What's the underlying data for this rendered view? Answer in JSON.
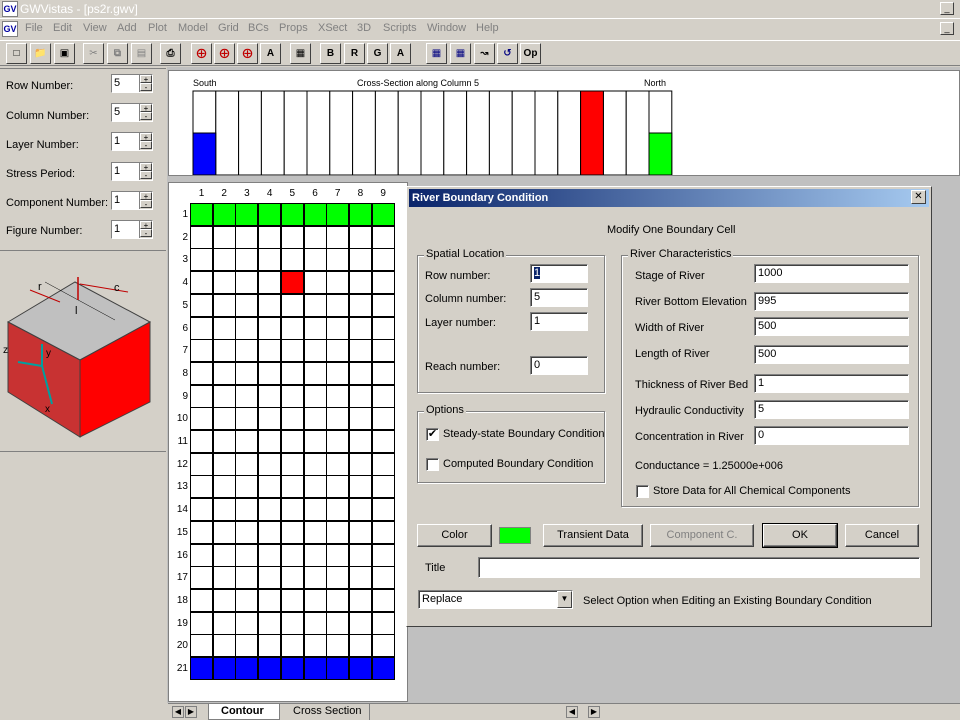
{
  "window": {
    "title": "GWVistas - [ps2r.gwv]",
    "icon": "gw-app-icon"
  },
  "menu": [
    "File",
    "Edit",
    "View",
    "Add",
    "Plot",
    "Model",
    "Grid",
    "BCs",
    "Props",
    "XSect",
    "3D",
    "Scripts",
    "Window",
    "Help"
  ],
  "toolbar": {
    "text_buttons": {
      "b": "B",
      "r": "R",
      "g": "G",
      "a": "A",
      "op": "Op"
    }
  },
  "left_panel": {
    "fields": [
      {
        "label": "Row Number:",
        "value": "5"
      },
      {
        "label": "Column Number:",
        "value": "5"
      },
      {
        "label": "Layer Number:",
        "value": "1"
      },
      {
        "label": "Stress Period:",
        "value": "1"
      },
      {
        "label": "Component Number:",
        "value": "1"
      },
      {
        "label": "Figure Number:",
        "value": "1"
      }
    ],
    "cube_labels": {
      "r": "r",
      "c": "c",
      "l": "l",
      "z": "z",
      "y": "y",
      "x": "x"
    }
  },
  "cross_section": {
    "title": "Cross-Section along Column  5",
    "left_label": "South",
    "right_label": "North",
    "colors": {
      "river": "#ff0000",
      "bottom": "#0000ff",
      "top": "#00ff00"
    }
  },
  "grid": {
    "columns": [
      "1",
      "2",
      "3",
      "4",
      "5",
      "6",
      "7",
      "8",
      "9"
    ],
    "rows": [
      "1",
      "2",
      "3",
      "4",
      "5",
      "6",
      "7",
      "8",
      "9",
      "10",
      "11",
      "12",
      "13",
      "14",
      "15",
      "16",
      "17",
      "18",
      "19",
      "20",
      "21"
    ],
    "colors": {
      "top_row": "#00ff00",
      "bottom_row": "#0000ff",
      "river_cell": "#ff0000"
    }
  },
  "tabs": {
    "contour": "Contour",
    "cross_section": "Cross Section"
  },
  "dialog": {
    "title": "River Boundary Condition",
    "header": "Modify One Boundary Cell",
    "spatial": {
      "title": "Spatial Location",
      "row_label": "Row number:",
      "row_value": "1",
      "col_label": "Column number:",
      "col_value": "5",
      "layer_label": "Layer number:",
      "layer_value": "1",
      "reach_label": "Reach number:",
      "reach_value": "0"
    },
    "options": {
      "title": "Options",
      "steady_label": "Steady-state Boundary Condition",
      "steady_checked": true,
      "computed_label": "Computed Boundary Condition",
      "computed_checked": false
    },
    "river": {
      "title": "River Characteristics",
      "stage_label": "Stage of River",
      "stage_value": "1000",
      "bottom_label": "River Bottom Elevation",
      "bottom_value": "995",
      "width_label": "Width of River",
      "width_value": "500",
      "length_label": "Length of River",
      "length_value": "500",
      "thick_label": "Thickness of River Bed",
      "thick_value": "1",
      "k_label": "Hydraulic Conductivity",
      "k_value": "5",
      "conc_label": "Concentration in River",
      "conc_value": "0",
      "conductance": "Conductance = 1.25000e+006",
      "store_label": "Store Data for All Chemical Components",
      "store_checked": false
    },
    "buttons": {
      "color": "Color",
      "transient": "Transient Data",
      "component": "Component C.",
      "ok": "OK",
      "cancel": "Cancel"
    },
    "swatch_color": "#00ff00",
    "title_label": "Title",
    "title_value": "",
    "replace_value": "Replace",
    "replace_hint": "Select Option when Editing an Existing Boundary Condition"
  }
}
